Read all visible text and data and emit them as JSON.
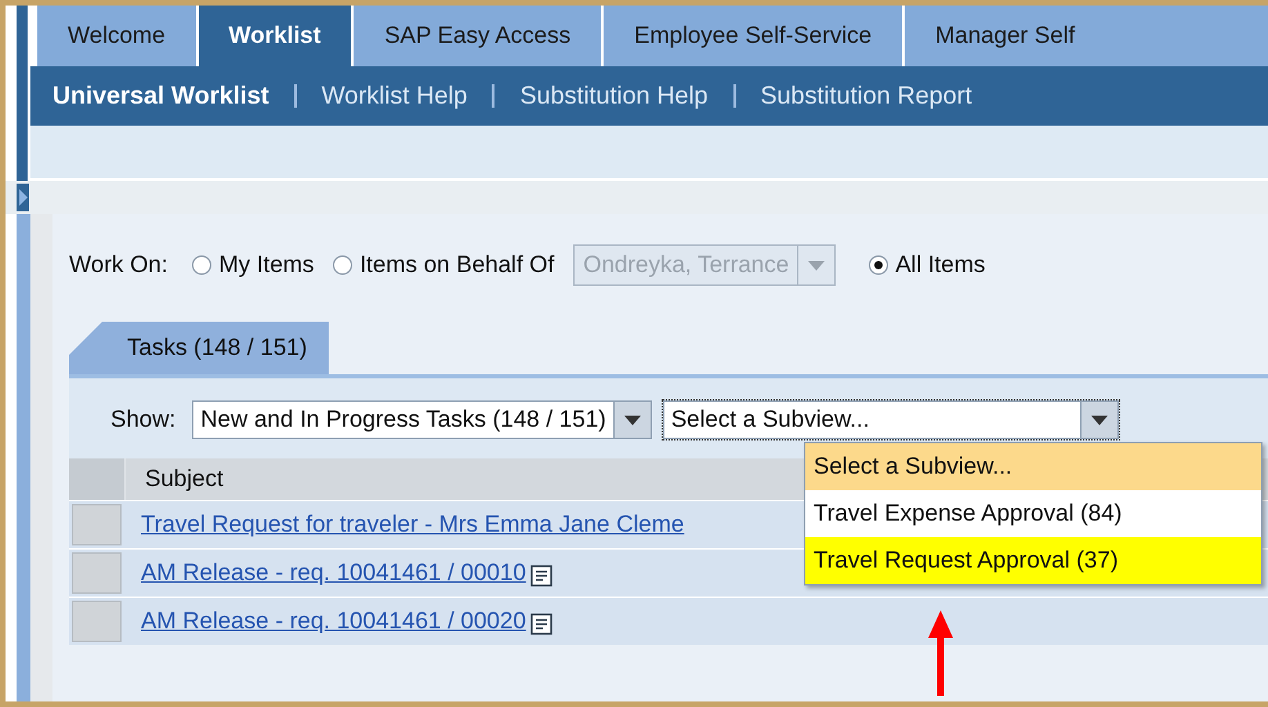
{
  "top_tabs": [
    {
      "label": "Welcome",
      "selected": false
    },
    {
      "label": "Worklist",
      "selected": true
    },
    {
      "label": "SAP Easy Access",
      "selected": false
    },
    {
      "label": "Employee Self-Service",
      "selected": false
    },
    {
      "label": "Manager Self",
      "selected": false
    }
  ],
  "sub_nav": [
    {
      "label": "Universal Worklist",
      "selected": true
    },
    {
      "label": "Worklist Help",
      "selected": false
    },
    {
      "label": "Substitution Help",
      "selected": false
    },
    {
      "label": "Substitution Report",
      "selected": false
    }
  ],
  "work_on": {
    "label": "Work On:",
    "options": [
      {
        "label": "My Items",
        "selected": false
      },
      {
        "label": "Items on Behalf Of",
        "selected": false
      },
      {
        "label": "All Items",
        "selected": true
      }
    ],
    "behalf_of": {
      "value": "Ondreyka, Terrance",
      "disabled": true
    }
  },
  "task_tab": {
    "label": "Tasks  (148 / 151)",
    "selected": true
  },
  "show": {
    "label": "Show:",
    "filter": "New and In Progress Tasks  (148 / 151)",
    "subview": "Select a Subview...",
    "subview_options": [
      {
        "label": "Select a Subview...",
        "selected": true,
        "highlighted": false
      },
      {
        "label": "Travel Expense Approval  (84)",
        "selected": false,
        "highlighted": false
      },
      {
        "label": "Travel Request Approval  (37)",
        "selected": false,
        "highlighted": true
      }
    ]
  },
  "table": {
    "columns": [
      "Subject"
    ],
    "rows": [
      {
        "subject": "Travel Request for traveler - Mrs Emma Jane Cleme",
        "note": false
      },
      {
        "subject": "AM Release - req. 10041461 / 00010",
        "note": true
      },
      {
        "subject": "AM Release - req. 10041461 / 00020",
        "note": true
      }
    ]
  },
  "annotation": {
    "kind": "arrow"
  }
}
